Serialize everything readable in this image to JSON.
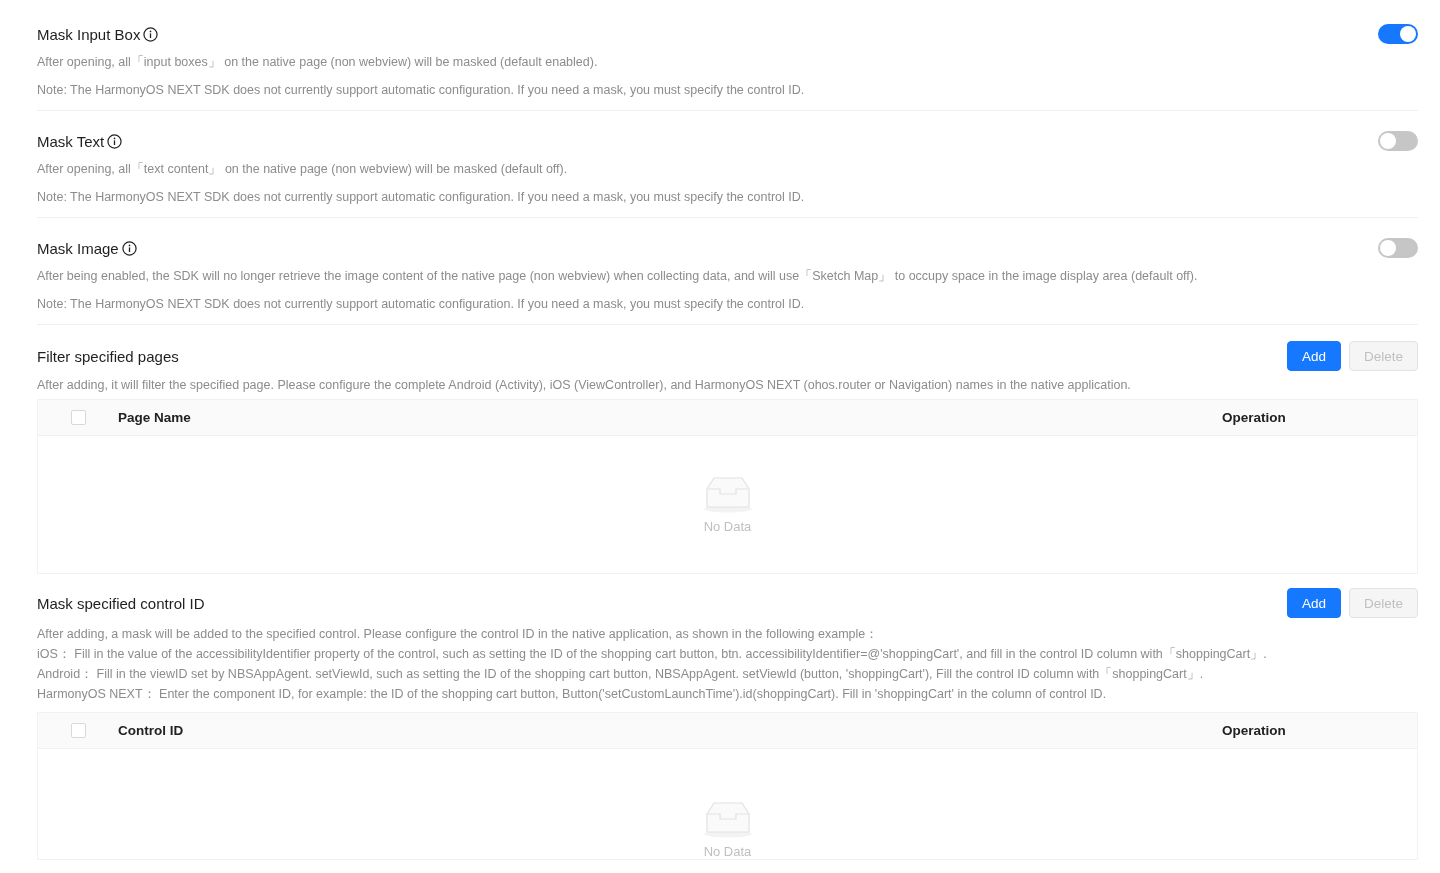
{
  "settings": [
    {
      "title": "Mask Input Box",
      "on": true,
      "lines": [
        "After opening, all「input boxes」 on the native page (non webview) will be masked (default enabled).",
        "Note: The HarmonyOS NEXT SDK does not currently support automatic configuration. If you need a mask, you must specify the control ID."
      ]
    },
    {
      "title": "Mask Text",
      "on": false,
      "lines": [
        "After opening, all「text content」 on the native page (non webview) will be masked (default off).",
        "Note: The HarmonyOS NEXT SDK does not currently support automatic configuration. If you need a mask, you must specify the control ID."
      ]
    },
    {
      "title": "Mask Image",
      "on": false,
      "lines": [
        "After being enabled, the SDK will no longer retrieve the image content of the native page (non webview) when collecting data, and will use「Sketch Map」 to occupy space in the image display area (default off).",
        "Note: The HarmonyOS NEXT SDK does not currently support automatic configuration. If you need a mask, you must specify the control ID."
      ]
    }
  ],
  "lists": [
    {
      "title": "Filter specified pages",
      "buttons": [
        {
          "label": "Add",
          "kind": "primary",
          "disabled": false
        },
        {
          "label": "Delete",
          "kind": "default",
          "disabled": true
        }
      ],
      "lines": [
        "After adding, it will filter the specified page. Please configure the complete Android (Activity), iOS (ViewController), and HarmonyOS NEXT (ohos.router or Navigation) names in the native application."
      ],
      "table": {
        "select_all_checked": false,
        "columns": [
          "Page Name",
          "Operation"
        ],
        "empty_text": "No Data"
      }
    },
    {
      "title": "Mask specified control ID",
      "buttons": [
        {
          "label": "Add",
          "kind": "primary",
          "disabled": false
        },
        {
          "label": "Delete",
          "kind": "default",
          "disabled": true
        }
      ],
      "lines": [
        "After adding, a mask will be added to the specified control. Please configure the control ID in the native application, as shown in the following example：",
        "iOS： Fill in the value of the accessibilityIdentifier property of the control, such as setting the ID of the shopping cart button, btn. accessibilityIdentifier=@'shoppingCart', and fill in the control ID column with「shoppingCart」.",
        "Android： Fill in the viewID set by NBSAppAgent. setViewId, such as setting the ID of the shopping cart button, NBSAppAgent. setViewId (button, 'shoppingCart'), Fill the control ID column with「shoppingCart」.",
        "HarmonyOS NEXT： Enter the component ID, for example: the ID of the shopping cart button, Button('setCustomLaunchTime').id(shoppingCart). Fill in 'shoppingCart' in the column of control ID."
      ],
      "table": {
        "select_all_checked": false,
        "columns": [
          "Control ID",
          "Operation"
        ],
        "empty_text": "No Data"
      }
    }
  ]
}
